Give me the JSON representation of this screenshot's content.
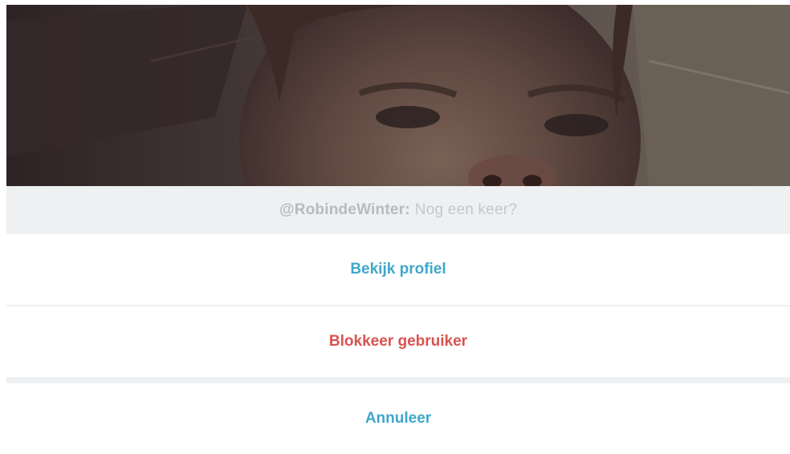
{
  "message": {
    "user": "@RobindeWinter:",
    "text": "Nog een keer?"
  },
  "actions": {
    "view_profile": "Bekijk profiel",
    "block_user": "Blokkeer gebruiker",
    "cancel": "Annuleer"
  },
  "colors": {
    "accent": "#3fa7c9",
    "destructive": "#d9534f",
    "message_bg": "#eef0f2"
  }
}
